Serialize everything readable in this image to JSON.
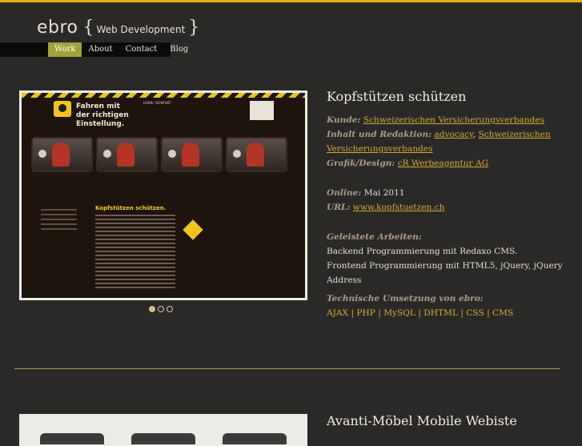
{
  "brand": {
    "name": "ebro",
    "open": "{",
    "tagline": "Web Development",
    "close": "}"
  },
  "nav": {
    "items": [
      "Work",
      "About",
      "Contact",
      "Blog"
    ],
    "active": "Work"
  },
  "project1": {
    "title": "Kopfstützen schützen",
    "client_label": "Kunde:",
    "client": "Schweizerischen Versicherungsverbandes",
    "content_label": "Inhalt und Redaktion:",
    "content_a": "advocacy",
    "content_sep": ", ",
    "content_b": "Schweizerischen Versicherungsverbandes",
    "design_label": "Grafik/Design:",
    "design": "cR Werbeagentur AG",
    "online_label": "Online:",
    "online": "Mai 2011",
    "url_label": "URL:",
    "url": "www.kopfstuetzen.ch",
    "work_label": "Geleistete Arbeiten:",
    "work_items": [
      "Backend Programmierung mit Redaxo CMS.",
      "Frontend Programmierung mit HTML5, jQuery, jQuery Address"
    ],
    "tech_label": "Technische Umsetzung von ebro:",
    "tech": "AJAX | PHP | MySQL | DHTML | CSS | CMS",
    "screenshot": {
      "headline_1": "Fahren mit",
      "headline_2": "der richtigen",
      "headline_3": "Einstellung.",
      "menu": "HOME / KONTAKT",
      "article_title": "Kopfstützen schützen."
    },
    "slides": {
      "count": 3,
      "active": 0
    }
  },
  "project2": {
    "title": "Avanti-Möbel Mobile Webiste"
  },
  "colors": {
    "accent": "#e4b21c",
    "nav_active": "#a1a23a",
    "link": "#d4a838",
    "background": "#2b2927"
  }
}
